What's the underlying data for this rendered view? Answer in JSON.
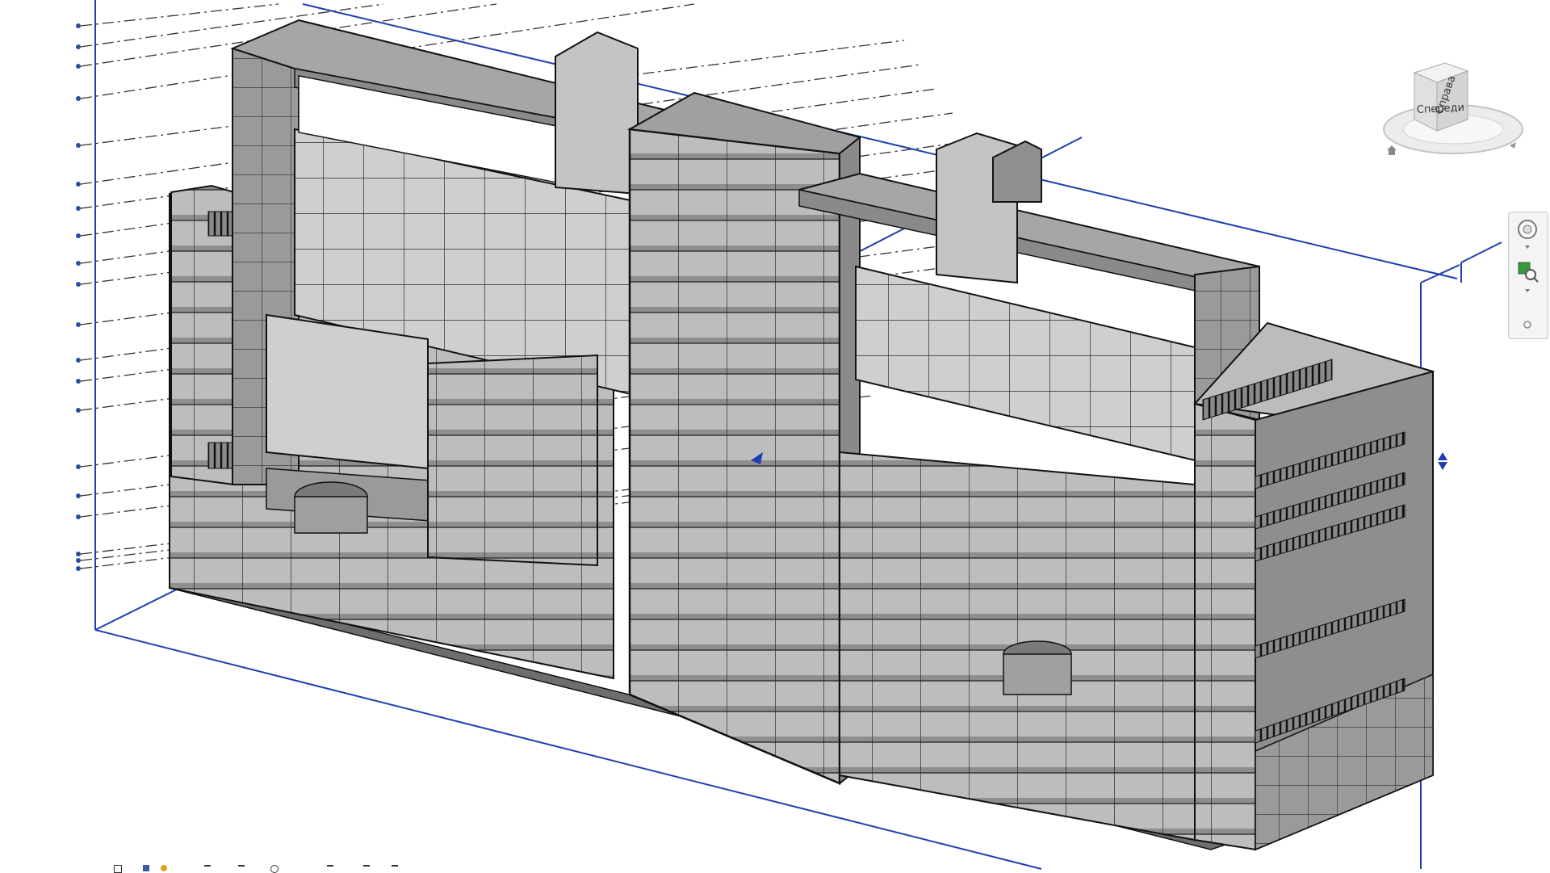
{
  "viewcube": {
    "face_front": "Спереди",
    "face_right": "Справа"
  },
  "icons": {
    "home": "home-icon",
    "steering_wheel": "steering-wheel-icon",
    "zoom": "zoom-region-icon",
    "section_box_grip": "section-box-grip-icon"
  },
  "colors": {
    "background": "#ffffff",
    "model_light": "#d4d4d4",
    "model_mid": "#a8a8a8",
    "model_dark": "#7c7c7c",
    "edge": "#1a1a1a",
    "section_box": "#1f3fb0",
    "level_lines": "#333333",
    "navbar_accent": "#3a9a3a"
  },
  "status_bar": {
    "icons": [
      "scale-icon",
      "detail-level-icon",
      "visual-style-icon",
      "sun-path-icon",
      "shadows-icon",
      "crop-icon",
      "temporary-hide-icon",
      "reveal-hidden-icon",
      "analytical-model-icon"
    ]
  }
}
